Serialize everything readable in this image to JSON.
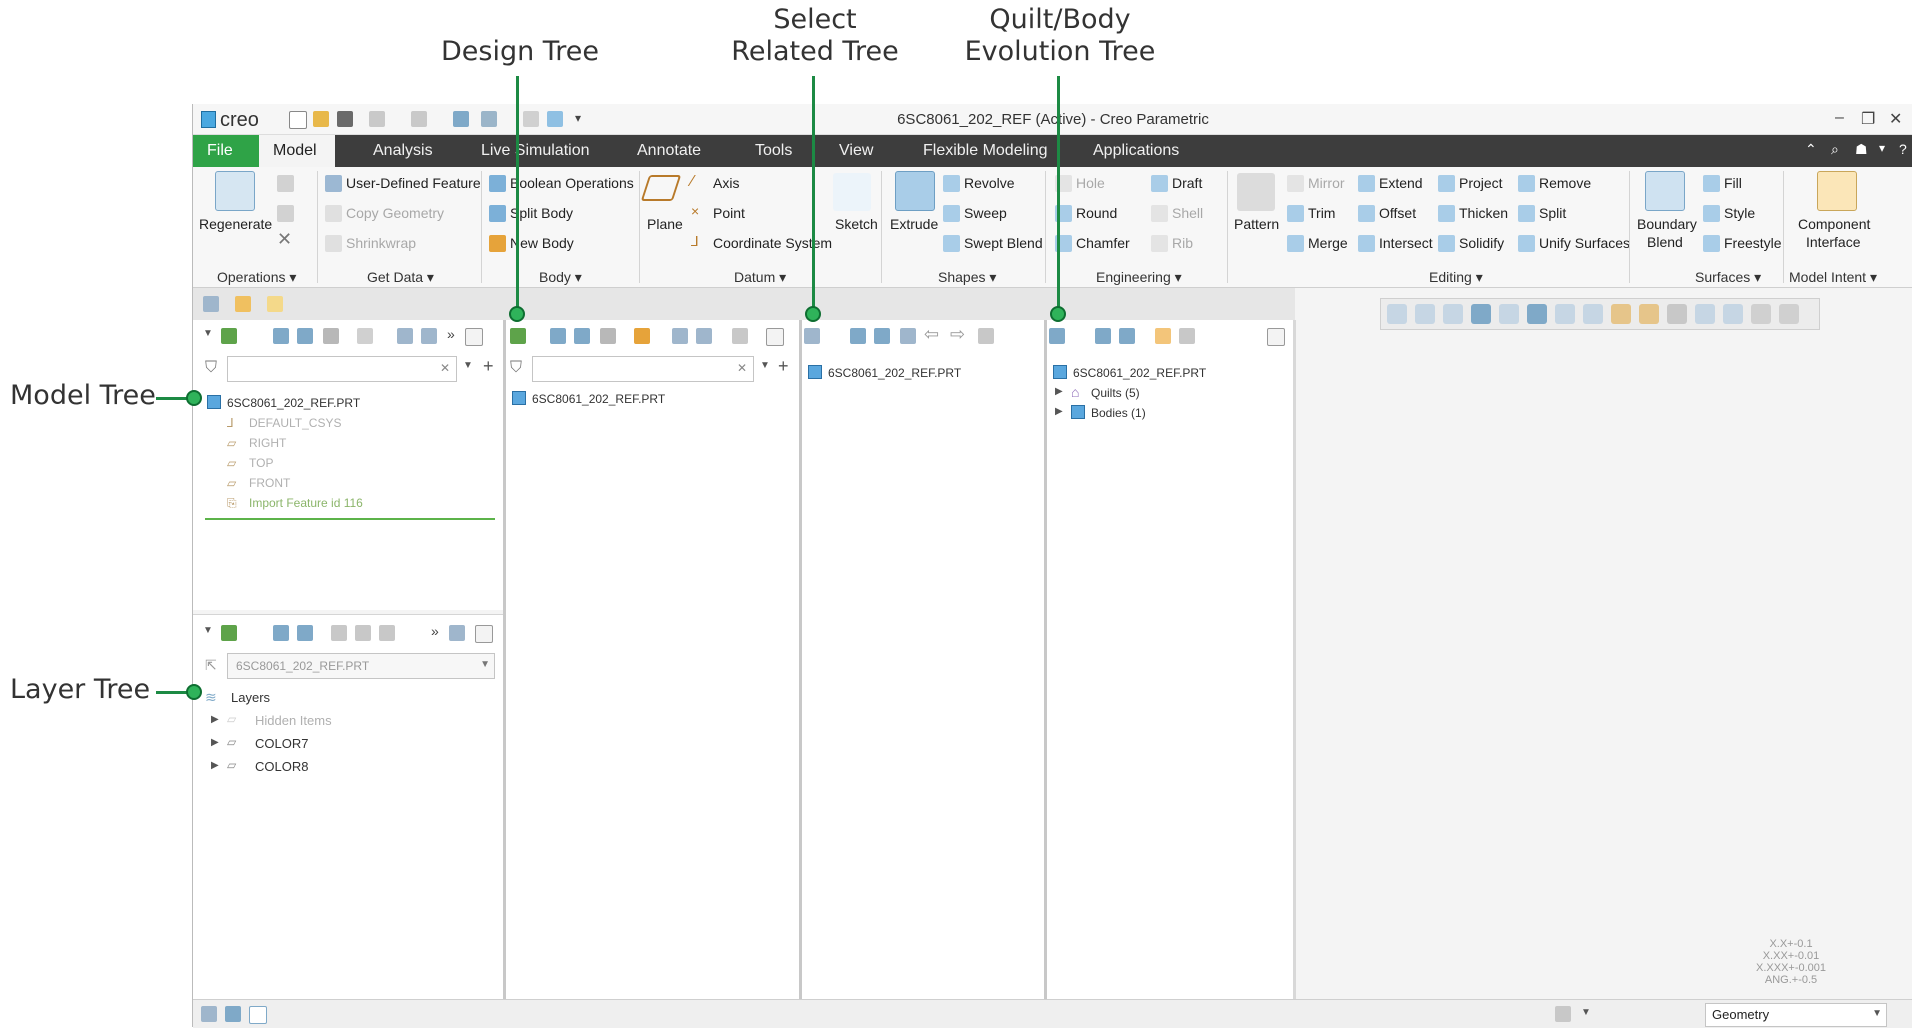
{
  "callouts": {
    "design_tree": "Design Tree",
    "select_related_line1": "Select",
    "select_related_line2": "Related Tree",
    "quilt_line1": "Quilt/Body",
    "quilt_line2": "Evolution Tree",
    "model_tree": "Model Tree",
    "layer_tree": "Layer Tree"
  },
  "window": {
    "logo": "creo",
    "title": "6SC8061_202_REF (Active) - Creo Parametric",
    "minimize": "–",
    "restore": "❐",
    "close": "✕"
  },
  "menubar": {
    "tabs": [
      "File",
      "Model",
      "Analysis",
      "Live Simulation",
      "Annotate",
      "Tools",
      "View",
      "Flexible Modeling",
      "Applications"
    ]
  },
  "ribbon": {
    "regenerate": "Regenerate",
    "user_defined_feature": "User-Defined Feature",
    "copy_geometry": "Copy Geometry",
    "shrinkwrap": "Shrinkwrap",
    "boolean_operations": "Boolean Operations",
    "split_body": "Split Body",
    "new_body": "New Body",
    "plane": "Plane",
    "axis": "Axis",
    "point": "Point",
    "coordinate_system": "Coordinate System",
    "sketch": "Sketch",
    "extrude": "Extrude",
    "revolve": "Revolve",
    "sweep": "Sweep",
    "swept_blend": "Swept Blend",
    "hole": "Hole",
    "round": "Round",
    "chamfer": "Chamfer",
    "draft": "Draft",
    "shell": "Shell",
    "rib": "Rib",
    "pattern": "Pattern",
    "mirror": "Mirror",
    "trim": "Trim",
    "merge": "Merge",
    "extend": "Extend",
    "offset": "Offset",
    "intersect": "Intersect",
    "project": "Project",
    "thicken": "Thicken",
    "solidify": "Solidify",
    "remove": "Remove",
    "split": "Split",
    "unify_surfaces": "Unify Surfaces",
    "boundary_blend_1": "Boundary",
    "boundary_blend_2": "Blend",
    "fill": "Fill",
    "style": "Style",
    "freestyle": "Freestyle",
    "component_interface_1": "Component",
    "component_interface_2": "Interface",
    "groups": {
      "operations": "Operations ▾",
      "get_data": "Get Data ▾",
      "body": "Body ▾",
      "datum": "Datum ▾",
      "shapes": "Shapes ▾",
      "engineering": "Engineering ▾",
      "editing": "Editing ▾",
      "surfaces": "Surfaces ▾",
      "model_intent": "Model Intent ▾"
    }
  },
  "model_tree": {
    "root": "6SC8061_202_REF.PRT",
    "items": [
      "DEFAULT_CSYS",
      "RIGHT",
      "TOP",
      "FRONT",
      "Import Feature id 116"
    ]
  },
  "layer_tree": {
    "model_select": "6SC8061_202_REF.PRT",
    "root": "Layers",
    "items": [
      "Hidden Items",
      "COLOR7",
      "COLOR8"
    ]
  },
  "design_tree": {
    "root": "6SC8061_202_REF.PRT"
  },
  "select_related_tree": {
    "root": "6SC8061_202_REF.PRT"
  },
  "evolution_tree": {
    "root": "6SC8061_202_REF.PRT",
    "items": [
      "Quilts (5)",
      "Bodies (1)"
    ]
  },
  "tolerances": [
    "X.X+-0.1",
    "X.XX+-0.01",
    "X.XXX+-0.001",
    "ANG.+-0.5"
  ],
  "status": {
    "filter_value": "Geometry"
  }
}
